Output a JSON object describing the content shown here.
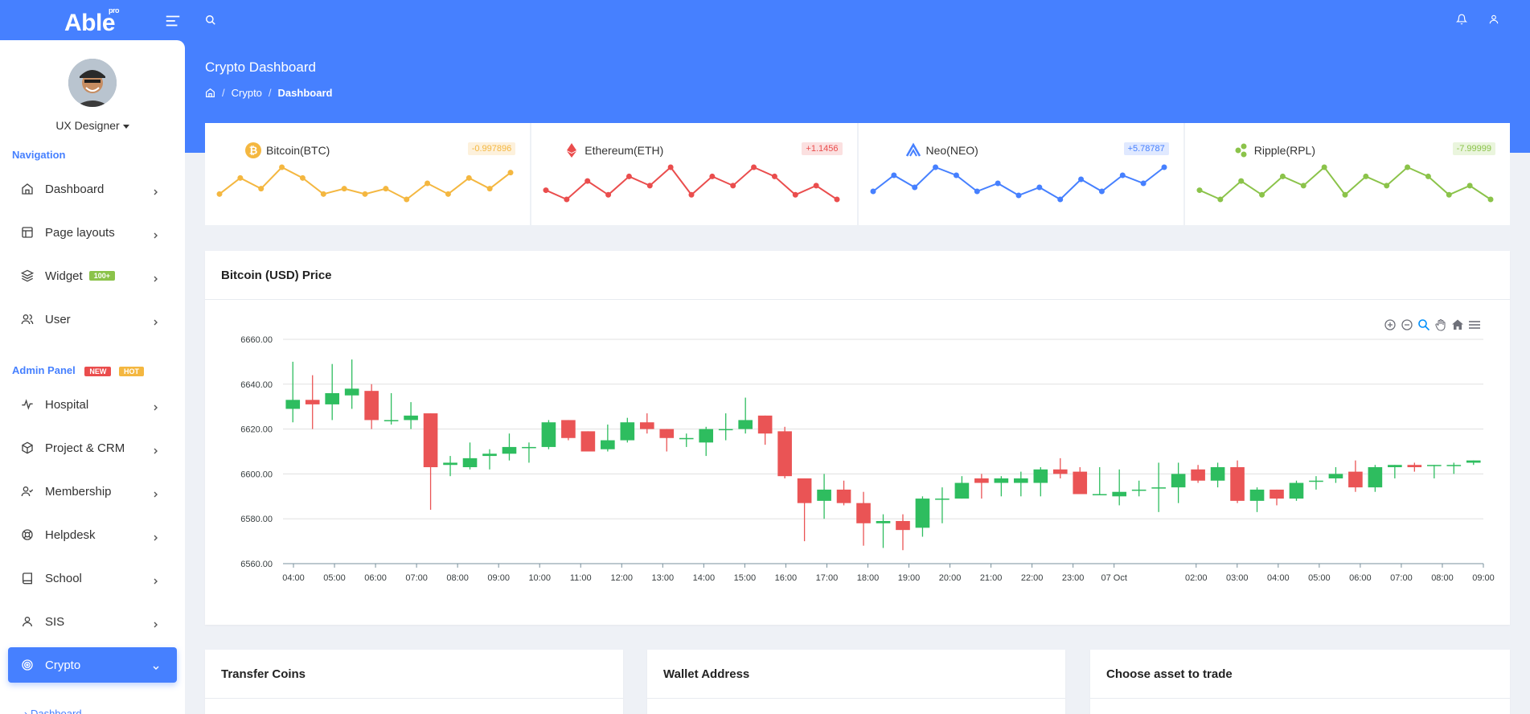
{
  "app": {
    "logo": "Able",
    "logo_sup": "pro"
  },
  "user": {
    "name": "UX Designer"
  },
  "sidebar": {
    "nav_caption": "Navigation",
    "items": [
      {
        "label": "Dashboard",
        "icon": "home-icon"
      },
      {
        "label": "Page layouts",
        "icon": "layout-icon"
      },
      {
        "label": "Widget",
        "icon": "layers-icon",
        "badge": "100+"
      },
      {
        "label": "User",
        "icon": "users-icon"
      }
    ],
    "admin_caption": "Admin Panel",
    "admin_badges": [
      "NEW",
      "HOT"
    ],
    "admin_items": [
      {
        "label": "Hospital",
        "icon": "activity-icon"
      },
      {
        "label": "Project & CRM",
        "icon": "box-icon"
      },
      {
        "label": "Membership",
        "icon": "user-check-icon"
      },
      {
        "label": "Helpdesk",
        "icon": "lifebuoy-icon"
      },
      {
        "label": "School",
        "icon": "book-icon"
      },
      {
        "label": "SIS",
        "icon": "user-icon"
      },
      {
        "label": "Crypto",
        "icon": "target-icon",
        "active": true
      }
    ],
    "sub_item": "Dashboard"
  },
  "header": {
    "title": "Crypto Dashboard",
    "breadcrumb": [
      "Crypto",
      "Dashboard"
    ]
  },
  "coins": [
    {
      "name": "Bitcoin(BTC)",
      "change": "-0.997896",
      "color": "#f4b740",
      "badge_bg": "#fdf1dc",
      "values": [
        3,
        6,
        4,
        8,
        6,
        3,
        4,
        3,
        4,
        2,
        5,
        3,
        6,
        4,
        7
      ]
    },
    {
      "name": "Ethereum(ETH)",
      "change": "+1.1456",
      "color": "#ea4d4d",
      "badge_bg": "#fbe0e0",
      "values": [
        4,
        2,
        6,
        3,
        7,
        5,
        9,
        3,
        7,
        5,
        9,
        7,
        3,
        5,
        2
      ]
    },
    {
      "name": "Neo(NEO)",
      "change": "+5.78787",
      "color": "#4680ff",
      "badge_bg": "#e0e9ff",
      "values": [
        3,
        7,
        4,
        9,
        7,
        3,
        5,
        2,
        4,
        1,
        6,
        3,
        7,
        5,
        9
      ]
    },
    {
      "name": "Ripple(RPL)",
      "change": "-7.99999",
      "color": "#8bc34a",
      "badge_bg": "#eaf5dd",
      "values": [
        4,
        2,
        6,
        3,
        7,
        5,
        9,
        3,
        7,
        5,
        9,
        7,
        3,
        5,
        2
      ]
    }
  ],
  "chart_card": {
    "title": "Bitcoin (USD) Price"
  },
  "bottom_cards": [
    "Transfer Coins",
    "Wallet Address",
    "Choose asset to trade"
  ],
  "chart_data": {
    "type": "candlestick",
    "title": "Bitcoin (USD) Price",
    "ylim": [
      6560,
      6660
    ],
    "y_ticks": [
      "6660.00",
      "6640.00",
      "6620.00",
      "6600.00",
      "6580.00",
      "6560.00"
    ],
    "x_ticks": [
      "04:00",
      "05:00",
      "06:00",
      "07:00",
      "08:00",
      "09:00",
      "10:00",
      "11:00",
      "12:00",
      "13:00",
      "14:00",
      "15:00",
      "16:00",
      "17:00",
      "18:00",
      "19:00",
      "20:00",
      "21:00",
      "22:00",
      "23:00",
      "07 Oct",
      "",
      "02:00",
      "03:00",
      "04:00",
      "05:00",
      "06:00",
      "07:00",
      "08:00",
      "09:00"
    ],
    "up_color": "#2ebd5f",
    "down_color": "#ea5455",
    "grid": true,
    "candles": [
      [
        6629,
        6650,
        6623,
        6633
      ],
      [
        6633,
        6644,
        6620,
        6631
      ],
      [
        6631,
        6649,
        6624,
        6636
      ],
      [
        6635,
        6651,
        6629,
        6638
      ],
      [
        6637,
        6640,
        6620,
        6624
      ],
      [
        6624,
        6636,
        6622,
        6624
      ],
      [
        6624,
        6632,
        6620,
        6626
      ],
      [
        6627,
        6627,
        6584,
        6603
      ],
      [
        6604,
        6608,
        6599,
        6605
      ],
      [
        6603,
        6614,
        6602,
        6607
      ],
      [
        6608,
        6611,
        6602,
        6609
      ],
      [
        6609,
        6618,
        6606,
        6612
      ],
      [
        6612,
        6614,
        6605,
        6612
      ],
      [
        6612,
        6624,
        6611,
        6623
      ],
      [
        6624,
        6624,
        6615,
        6616
      ],
      [
        6619,
        6619,
        6610,
        6610
      ],
      [
        6611,
        6622,
        6610,
        6615
      ],
      [
        6615,
        6625,
        6614,
        6623
      ],
      [
        6623,
        6627,
        6618,
        6620
      ],
      [
        6620,
        6620,
        6610,
        6616
      ],
      [
        6616,
        6618,
        6612,
        6616
      ],
      [
        6614,
        6621,
        6608,
        6620
      ],
      [
        6620,
        6627,
        6615,
        6620
      ],
      [
        6620,
        6634,
        6618,
        6624
      ],
      [
        6626,
        6626,
        6613,
        6618
      ],
      [
        6619,
        6621,
        6598,
        6599
      ],
      [
        6598,
        6598,
        6570,
        6587
      ],
      [
        6588,
        6600,
        6580,
        6593
      ],
      [
        6593,
        6597,
        6586,
        6587
      ],
      [
        6587,
        6592,
        6568,
        6578
      ],
      [
        6578,
        6582,
        6567,
        6579
      ],
      [
        6579,
        6582,
        6566,
        6575
      ],
      [
        6576,
        6590,
        6572,
        6589
      ],
      [
        6589,
        6594,
        6578,
        6589
      ],
      [
        6589,
        6599,
        6589,
        6596
      ],
      [
        6598,
        6600,
        6589,
        6596
      ],
      [
        6596,
        6599,
        6590,
        6598
      ],
      [
        6596,
        6601,
        6590,
        6598
      ],
      [
        6596,
        6603,
        6590,
        6602
      ],
      [
        6602,
        6607,
        6598,
        6600
      ],
      [
        6601,
        6603,
        6591,
        6591
      ],
      [
        6591,
        6603,
        6591,
        6591
      ],
      [
        6590,
        6602,
        6586,
        6592
      ],
      [
        6593,
        6597,
        6590,
        6593
      ],
      [
        6594,
        6605,
        6583,
        6594
      ],
      [
        6594,
        6605,
        6587,
        6600
      ],
      [
        6602,
        6604,
        6596,
        6597
      ],
      [
        6597,
        6605,
        6594,
        6603
      ],
      [
        6603,
        6606,
        6587,
        6588
      ],
      [
        6588,
        6594,
        6583,
        6593
      ],
      [
        6593,
        6593,
        6586,
        6589
      ],
      [
        6589,
        6597,
        6588,
        6596
      ],
      [
        6597,
        6599,
        6593,
        6597
      ],
      [
        6598,
        6603,
        6596,
        6600
      ],
      [
        6601,
        6606,
        6592,
        6594
      ],
      [
        6594,
        6604,
        6592,
        6603
      ],
      [
        6603,
        6604,
        6598,
        6604
      ],
      [
        6604,
        6605,
        6601,
        6603
      ],
      [
        6604,
        6604,
        6598,
        6604
      ],
      [
        6604,
        6605,
        6600,
        6604
      ],
      [
        6605,
        6606,
        6604,
        6606
      ]
    ]
  }
}
